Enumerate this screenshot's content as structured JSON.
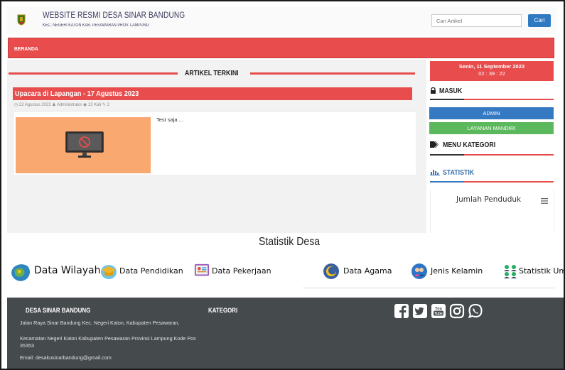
{
  "header": {
    "title": "WEBSITE RESMI DESA SINAR BANDUNG",
    "subtitle": "KEC. NEGERI KATON KAB. PESAWARAN PROV. LAMPUNG",
    "search_placeholder": "Cari Artikel",
    "search_button": "Cari"
  },
  "nav": {
    "items": [
      {
        "label": "BERANDA"
      }
    ]
  },
  "main": {
    "section_title": "ARTIKEL TERKINI",
    "article": {
      "title": "Upacara di Lapangan - 17 Agustus 2023",
      "meta": "◷ 22 Agustus 2023  ♟ Administrator  ◉ 13 Kali  ✎ 2",
      "excerpt": "Test saja ..."
    }
  },
  "sidebar": {
    "date": "Senin, 11 September 2023",
    "time": "02 : 39 : 22",
    "masuk_heading": "MASUK",
    "admin_button": "ADMIN",
    "layanan_button": "LAYANAN MANDIRI",
    "kategori_heading": "MENU KATEGORI",
    "statistik_heading": "STATISTIK",
    "chart_title": "Jumlah Penduduk"
  },
  "statistik_desa": {
    "title": "Statistik Desa",
    "items": [
      {
        "label": "Data Wilayah",
        "icon": "map-icon"
      },
      {
        "label": "Data Pendidikan",
        "icon": "graduation-cap-icon"
      },
      {
        "label": "Data Pekerjaan",
        "icon": "occupation-icon"
      },
      {
        "label": "Data Agama",
        "icon": "religion-icon"
      },
      {
        "label": "Jenis Kelamin",
        "icon": "gender-icon"
      },
      {
        "label": "Statistik Um",
        "icon": "people-icon"
      }
    ]
  },
  "footer": {
    "org_title": "DESA SINAR BANDUNG",
    "address_1": "Jalan Raya Sinar Bandung Kec. Negeri Katon, Kabupaten Pesawaran,",
    "address_2": "Kecamatan Negeri Katon Kabupaten Pesawaran Provinsi Lampung Kode Pos 35353",
    "email": "Email: desakusinarbandung@gmail.com",
    "kategori_title": "KATEGORI",
    "social": [
      "facebook-icon",
      "twitter-icon",
      "youtube-icon",
      "instagram-icon",
      "whatsapp-icon"
    ]
  },
  "colors": {
    "accent_red": "#e84c4c",
    "admin_blue": "#3579c2",
    "layanan_green": "#5cb85c",
    "footer_bg": "#454a4d"
  }
}
